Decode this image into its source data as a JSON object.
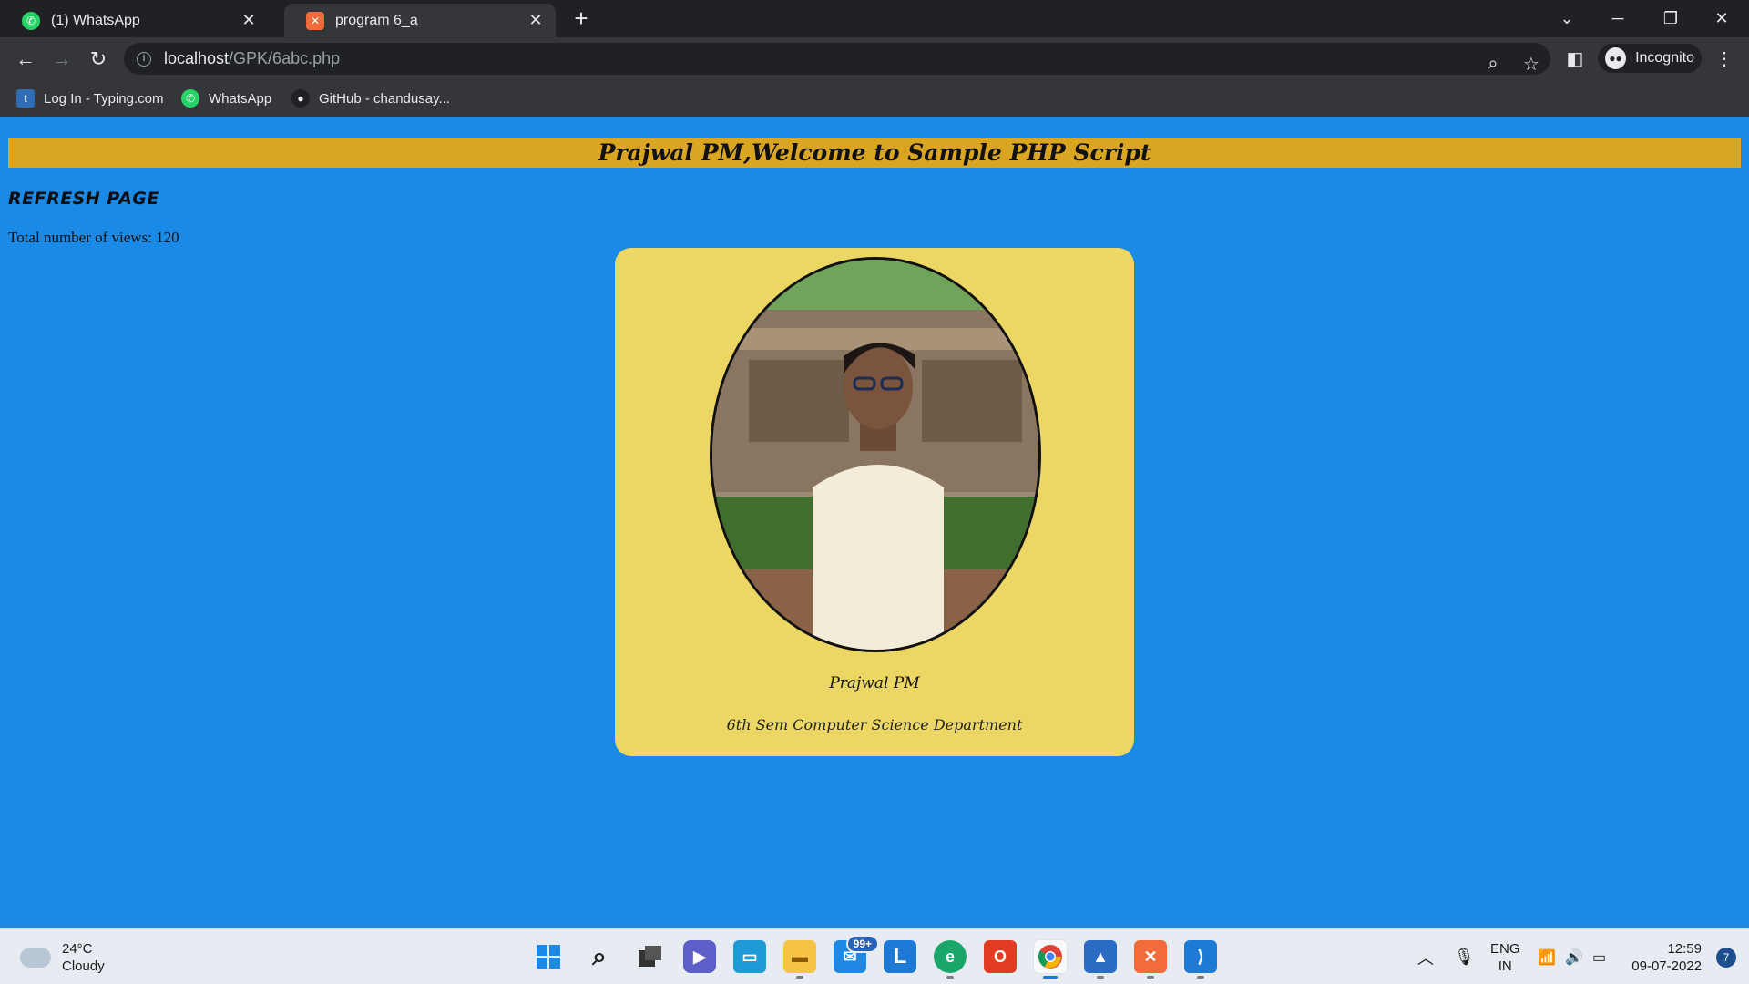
{
  "browser": {
    "tabs": [
      {
        "title": "(1) WhatsApp",
        "active": false
      },
      {
        "title": "program 6_a",
        "active": true
      }
    ],
    "url_host": "localhost",
    "url_path": "/GPK/6abc.php",
    "incognito_label": "Incognito",
    "bookmarks": [
      {
        "label": "Log In - Typing.com"
      },
      {
        "label": "WhatsApp"
      },
      {
        "label": "GitHub - chandusay..."
      }
    ]
  },
  "page": {
    "banner": "Prajwal PM,Welcome to Sample PHP Script",
    "refresh_link": "REFRESH PAGE",
    "views_text": "Total number of views: 120",
    "card": {
      "name": "Prajwal PM",
      "department": "6th Sem Computer Science Department"
    },
    "colors": {
      "background": "#1a8ae6",
      "banner": "#daa520",
      "card": "#ecd765"
    }
  },
  "taskbar": {
    "weather_temp": "24°C",
    "weather_desc": "Cloudy",
    "mail_badge": "99+",
    "lang_line1": "ENG",
    "lang_line2": "IN",
    "time": "12:59",
    "date": "09-07-2022",
    "notification_count": "7"
  }
}
